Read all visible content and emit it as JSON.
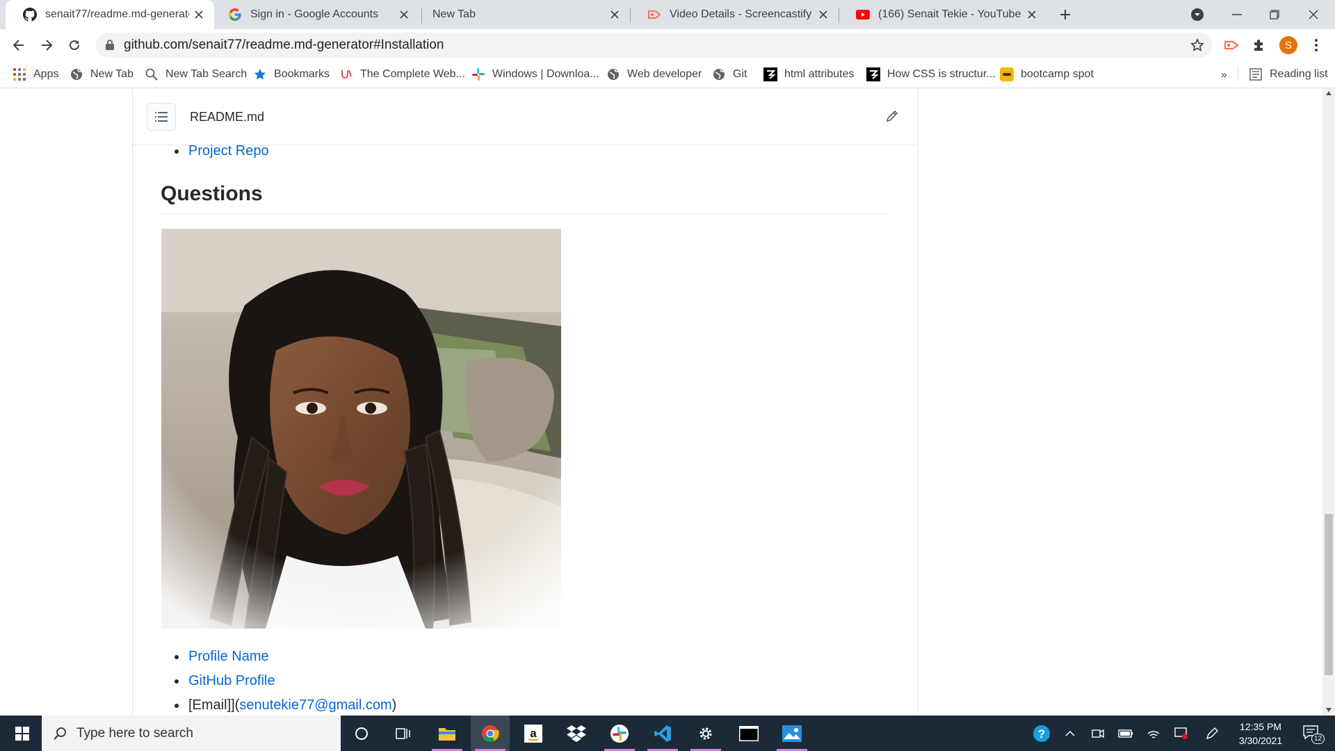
{
  "browser": {
    "tabs": [
      {
        "title": "senait77/readme.md-generator",
        "icon": "github-icon",
        "active": true
      },
      {
        "title": "Sign in - Google Accounts",
        "icon": "google-icon"
      },
      {
        "title": "New Tab",
        "icon": ""
      },
      {
        "title": "Video Details - Screencastify",
        "icon": "screencastify-icon"
      },
      {
        "title": "(166) Senait Tekie - YouTube",
        "icon": "youtube-icon"
      }
    ],
    "url": "github.com/senait77/readme.md-generator#Installation",
    "profile_initial": "S",
    "bookmarks": [
      {
        "label": "Apps",
        "icon": "apps-grid-icon"
      },
      {
        "label": "New Tab",
        "icon": "globe-icon"
      },
      {
        "label": "New Tab Search",
        "icon": "search-icon"
      },
      {
        "label": "Bookmarks",
        "icon": "star-icon"
      },
      {
        "label": "The Complete Web...",
        "icon": "udemy-icon"
      },
      {
        "label": "Windows | Downloa...",
        "icon": "slack-icon"
      },
      {
        "label": "Web developer",
        "icon": "globe-icon"
      },
      {
        "label": "Git",
        "icon": "globe-icon"
      },
      {
        "label": "html attributes",
        "icon": "codecademy-icon"
      },
      {
        "label": "How CSS is structur...",
        "icon": "codecademy-icon"
      },
      {
        "label": "bootcamp spot",
        "icon": "bootcamp-icon"
      }
    ],
    "overflow_chevron": "»",
    "reading_list": "Reading list"
  },
  "readme": {
    "file_name": "README.md",
    "project_repo_link": "Project Repo",
    "questions_heading": "Questions",
    "links": {
      "profile_name": "Profile Name",
      "github_profile": "GitHub Profile",
      "email_prefix": "[Email]](",
      "email": "senutekie77@gmail.com",
      "email_suffix": ")"
    }
  },
  "taskbar": {
    "search_placeholder": "Type here to search",
    "apps": [
      "cortana-icon",
      "task-view-icon",
      "file-explorer-icon",
      "chrome-icon",
      "amazon-icon",
      "dropbox-icon",
      "slack-icon",
      "vscode-icon",
      "settings-icon",
      "terminal-icon",
      "photos-icon"
    ],
    "time": "12:35 PM",
    "date": "3/30/2021",
    "notification_count": "12"
  },
  "colors": {
    "link": "#0366d6",
    "taskbar": "#1c2a38",
    "tab_strip": "#dee1e6",
    "profile_avatar": "#e8710a"
  }
}
